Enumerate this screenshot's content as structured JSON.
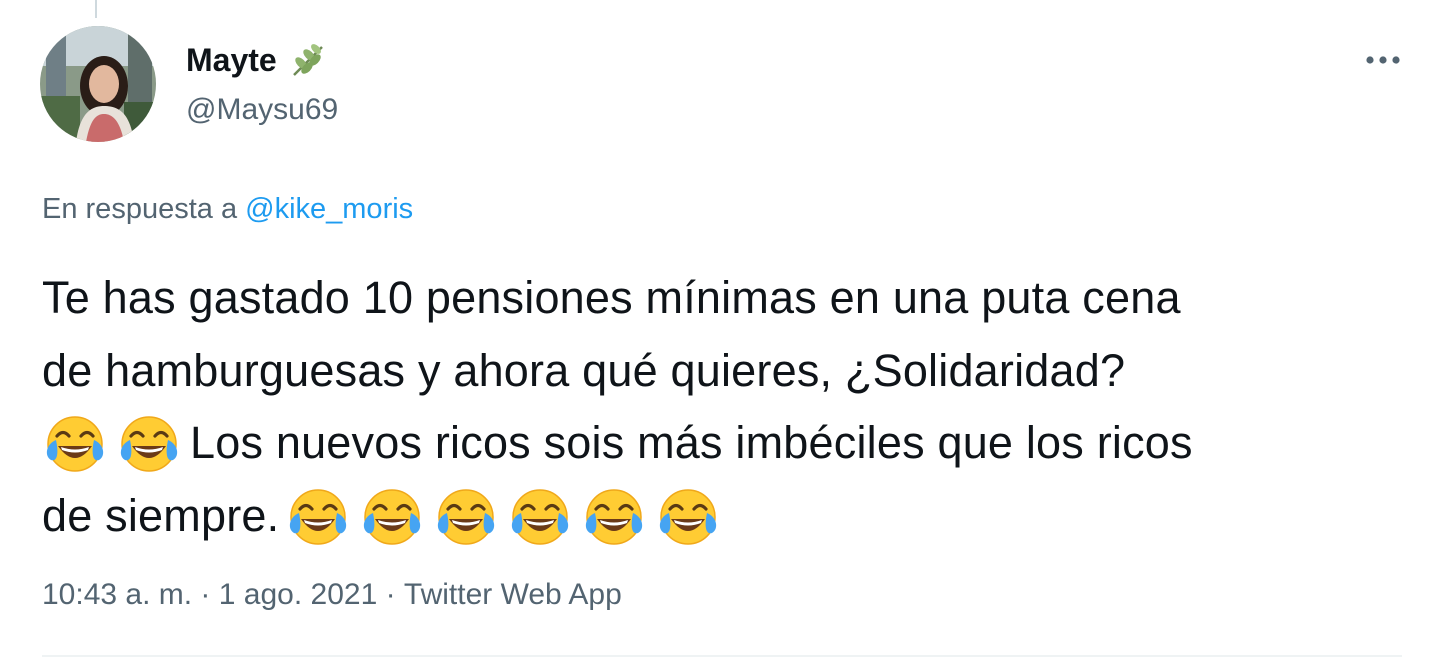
{
  "tweet": {
    "author": {
      "display_name": "Mayte",
      "name_decoration": "herb-sprig-icon",
      "handle": "@Maysu69"
    },
    "menu_icon": "more-horizontal-icon",
    "reply_prefix": "En respuesta a",
    "reply_to_handle": "@kike_moris",
    "text_lines": [
      "Te has gastado 10 pensiones mínimas en una puta cena",
      "de hamburguesas y ahora qué quieres, ¿Solidaridad?",
      "Los nuevos ricos sois más imbéciles que los ricos",
      "de siempre."
    ],
    "emoji": "face-with-tears-of-joy-icon",
    "time": "10:43 a. m.",
    "separator": " · ",
    "date": "1 ago. 2021",
    "source": "Twitter Web App"
  },
  "colors": {
    "text_primary": "#0f1419",
    "text_secondary": "#536471",
    "link": "#1d9bf0",
    "divider": "#eff3f4"
  }
}
